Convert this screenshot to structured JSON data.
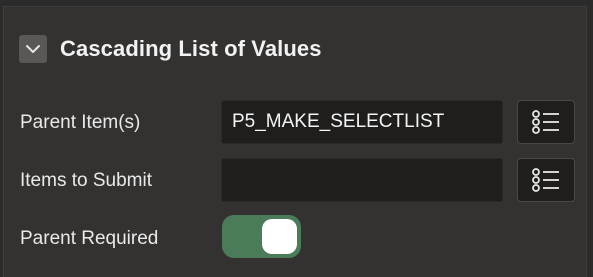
{
  "section": {
    "title": "Cascading List of Values",
    "expanded": true
  },
  "fields": {
    "parent_items": {
      "label": "Parent Item(s)",
      "value": "P5_MAKE_SELECTLIST",
      "button_icon": "list-icon"
    },
    "items_to_submit": {
      "label": "Items to Submit",
      "value": "",
      "button_icon": "list-icon"
    },
    "parent_required": {
      "label": "Parent Required",
      "enabled": true,
      "color": "#4a7c59"
    }
  },
  "icons": {
    "collapse": "chevron-down-icon"
  }
}
